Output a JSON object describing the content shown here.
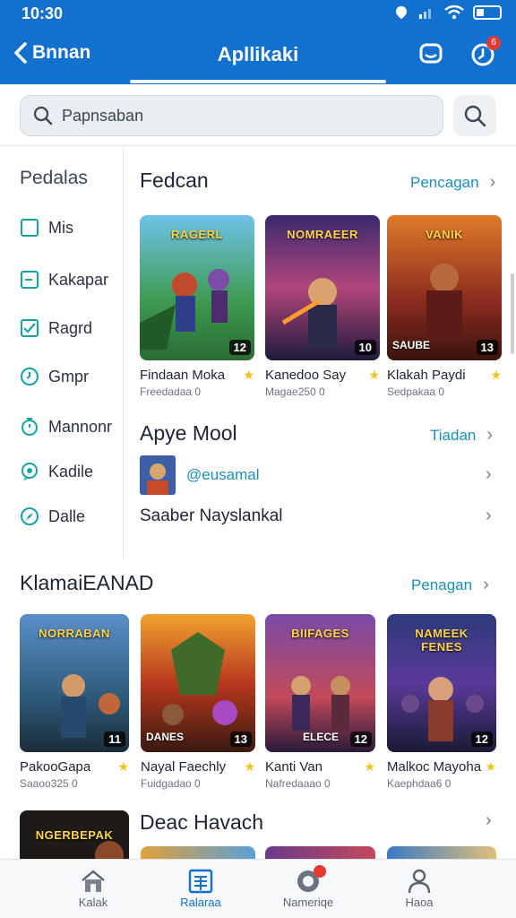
{
  "status": {
    "time": "10:30"
  },
  "header": {
    "back_label": "Bnnan",
    "title": "Apllikaki",
    "bell_badge": "6"
  },
  "search": {
    "placeholder": "Papnsaban"
  },
  "sidebar": {
    "title": "Pedalas",
    "items": [
      {
        "label": "Mis",
        "icon": "square-outline-icon"
      },
      {
        "label": "Kakapar",
        "icon": "square-minus-icon"
      },
      {
        "label": "Ragrd",
        "icon": "checkbox-icon"
      },
      {
        "label": "Gmpr",
        "icon": "clock-icon"
      },
      {
        "label": "Mannonr",
        "icon": "timer-icon"
      },
      {
        "label": "Kadile",
        "icon": "chat-bubble-icon"
      },
      {
        "label": "Dalle",
        "icon": "compass-icon"
      }
    ]
  },
  "featured": {
    "title": "Fedcan",
    "link": "Pencagan",
    "cards": [
      {
        "art_title": "RAGERL",
        "name": "Findaan Moka",
        "meta": "Freedadaa 0",
        "num": "12",
        "sub": ""
      },
      {
        "art_title": "NOMRAEER",
        "name": "Kanedoo Say",
        "meta": "Magae250 0",
        "num": "10",
        "sub": ""
      },
      {
        "art_title": "VANIK",
        "name": "Klakah Paydi",
        "meta": "Sedpakaa 0",
        "num": "13",
        "sub": "SAUBE"
      }
    ]
  },
  "apye": {
    "title": "Apye Mool",
    "link": "Tiadan",
    "rows": [
      {
        "label": "@eusamal"
      },
      {
        "label": "Saaber Nayslankal"
      }
    ]
  },
  "section2": {
    "title": "KlamaiEANAD",
    "link": "Penagan",
    "cards": [
      {
        "art_title": "NORRABAN",
        "name": "PakooGapa",
        "meta": "Saaoo325 0",
        "num": "11",
        "sub": ""
      },
      {
        "art_title": "",
        "name": "Nayal Faechly",
        "meta": "Fuidgadao 0",
        "num": "13",
        "sub": "DANES"
      },
      {
        "art_title": "BIIFAGES",
        "name": "Kanti Van",
        "meta": "Nafredaaao 0",
        "num": "12",
        "sub": "ELECE"
      },
      {
        "art_title": "NAMEEK FENES",
        "name": "Malkoc Mayoha",
        "meta": "Kaephdaa6 0",
        "num": "12",
        "sub": ""
      }
    ]
  },
  "section3": {
    "title": "Deac Havach",
    "first_art_title": "NGERBEPAK"
  },
  "bottom_nav": [
    {
      "label": "Kalak"
    },
    {
      "label": "Ralaraa"
    },
    {
      "label": "Nameriqe"
    },
    {
      "label": "Haoa"
    }
  ],
  "colors": {
    "primary": "#1270cf",
    "accent_link": "#1a8fb7",
    "icon_teal": "#16a3a3",
    "badge_red": "#e53935"
  }
}
